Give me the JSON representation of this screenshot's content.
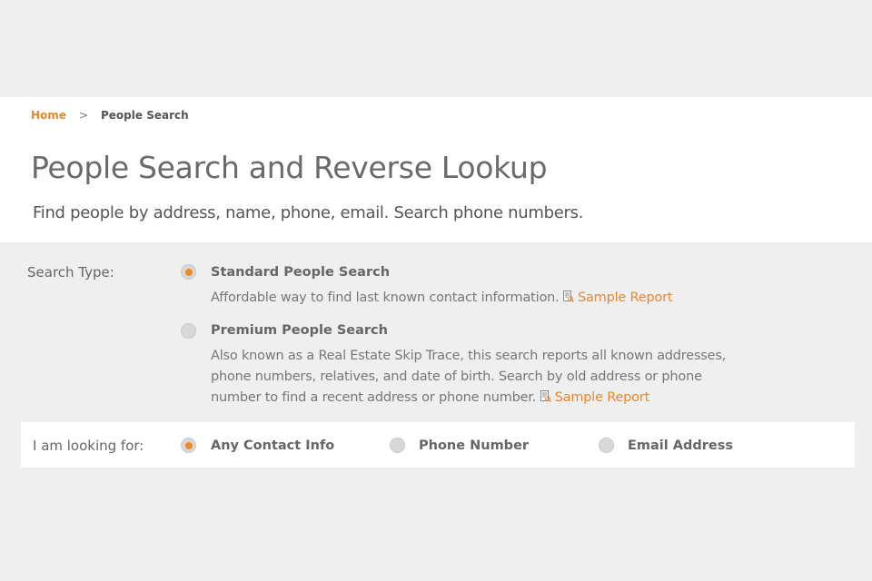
{
  "breadcrumb": {
    "home": "Home",
    "separator": ">",
    "current": "People Search"
  },
  "page": {
    "title": "People Search and Reverse Lookup",
    "subtitle": "Find people by address, name, phone, email. Search phone numbers."
  },
  "search_type": {
    "label": "Search Type:",
    "options": [
      {
        "title": "Standard People Search",
        "description": "Affordable way to find last known contact information.",
        "link": "Sample Report",
        "selected": true
      },
      {
        "title": "Premium People Search",
        "description": "Also known as a Real Estate Skip Trace, this search reports all known addresses, phone numbers, relatives, and date of birth. Search by old address or phone number to find a recent address or phone number.",
        "link": "Sample Report",
        "selected": false
      }
    ]
  },
  "looking_for": {
    "label": "I am looking for:",
    "options": [
      {
        "title": "Any Contact Info",
        "selected": true
      },
      {
        "title": "Phone Number",
        "selected": false
      },
      {
        "title": "Email Address",
        "selected": false
      }
    ]
  },
  "colors": {
    "accent": "#e8892f",
    "background": "#efefef",
    "panel": "#ffffff"
  }
}
